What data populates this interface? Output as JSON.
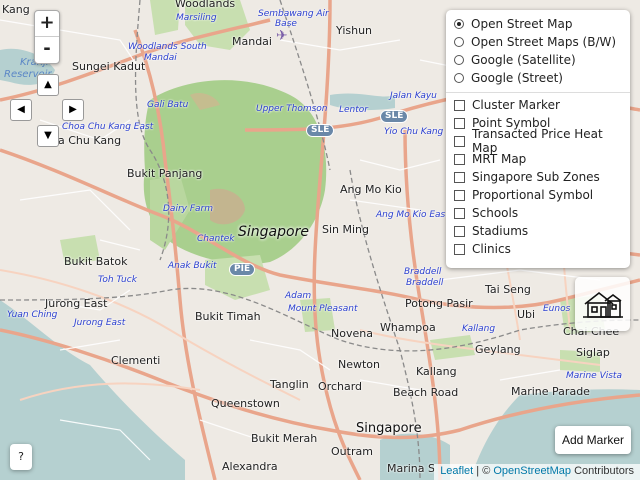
{
  "map": {
    "places": {
      "kang": "Kang",
      "woodlands": "Woodlands",
      "sembawang_air": "Sembawang Air",
      "base": "Base",
      "sungei_kadut": "Sungei Kadut",
      "mandai": "Mandai",
      "yishun": "Yishun",
      "kranji_reservoir_a": "Kranji",
      "kranji_reservoir_b": "Reservoir",
      "chua_chu_kang": "a Chu Kang",
      "bukit_panjang": "Bukit Panjang",
      "ang_mo_kio": "Ang Mo Kio",
      "singapore_center": "Singapore",
      "sin_ming": "Sin Ming",
      "bukit_batok": "Bukit Batok",
      "jurong_east": "Jurong East",
      "bukit_timah": "Bukit Timah",
      "potong_pasir": "Potong Pasir",
      "tai_seng": "Tai Seng",
      "whampoa": "Whampoa",
      "ubi": "Ubi",
      "novena": "Novena",
      "clementi": "Clementi",
      "geylang": "Geylang",
      "siglap": "Siglap",
      "newton": "Newton",
      "kallang": "Kallang",
      "tanglin": "Tanglin",
      "orchard": "Orchard",
      "marine_parade": "Marine Parade",
      "queenstown": "Queenstown",
      "beach_road": "Beach Road",
      "singapore_city": "Singapore",
      "bukit_merah": "Bukit Merah",
      "alexandra": "Alexandra",
      "outram": "Outram",
      "marina_south": "Marina S",
      "chai_chee": "Chai Chee"
    },
    "stations": {
      "marsiling": "Marsiling",
      "woodlands_south": "Woodlands South",
      "mandai_st": "Mandai",
      "gali_batu": "Gali Batu",
      "upper_thomson": "Upper Thomson",
      "lentor": "Lentor",
      "jalan_kayu": "Jalan Kayu",
      "yio_chu_kang": "Yio Chu Kang",
      "choa_chu_kang_east": "Choa Chu Kang East",
      "dairy_farm": "Dairy Farm",
      "chantek": "Chantek",
      "anak_bukit": "Anak Bukit",
      "ang_mo_kio_east": "Ang Mo Kio East",
      "braddell": "Braddell",
      "braddell2": "Braddell",
      "toh_tuck": "Toh Tuck",
      "adam": "Adam",
      "mount_pleasant": "Mount Pleasant",
      "yuan_ching": "Yuan Ching",
      "jurong_east_st": "Jurong East",
      "kallang_st": "Kallang",
      "eunos": "Eunos",
      "marine_vista": "Marine Vista"
    },
    "shields": {
      "sle1": "SLE",
      "sle2": "SLE",
      "pie": "PIE"
    }
  },
  "controls": {
    "zoom_in": "+",
    "zoom_out": "-",
    "pan_up": "▲",
    "pan_left": "◀",
    "pan_right": "▶",
    "pan_down": "▼"
  },
  "layers": {
    "base_layers": [
      {
        "label": "Open Street Map",
        "selected": true
      },
      {
        "label": "Open Street Maps (B/W)",
        "selected": false
      },
      {
        "label": "Google (Satellite)",
        "selected": false
      },
      {
        "label": "Google (Street)",
        "selected": false
      }
    ],
    "overlays": [
      {
        "label": "Cluster Marker",
        "checked": false
      },
      {
        "label": "Point Symbol",
        "checked": false
      },
      {
        "label": "Transacted Price Heat Map",
        "checked": false
      },
      {
        "label": "MRT Map",
        "checked": false
      },
      {
        "label": "Singapore Sub Zones",
        "checked": false
      },
      {
        "label": "Proportional Symbol",
        "checked": false
      },
      {
        "label": "Schools",
        "checked": false
      },
      {
        "label": "Stadiums",
        "checked": false
      },
      {
        "label": "Clinics",
        "checked": false
      }
    ]
  },
  "buttons": {
    "house_icon": "house-icon",
    "add_marker": "Add Marker",
    "help": "?"
  },
  "attribution": {
    "leaflet": "Leaflet",
    "separator": " | © ",
    "osm": "OpenStreetMap",
    "contributors": " Contributors"
  },
  "colors": {
    "land": "#f2efe9",
    "park": "#c8dfb0",
    "forest": "#a9cf8e",
    "water": "#b5d0d0",
    "road_major": "#f2b6a0",
    "road_minor": "#ffffff",
    "rail": "#999999"
  }
}
